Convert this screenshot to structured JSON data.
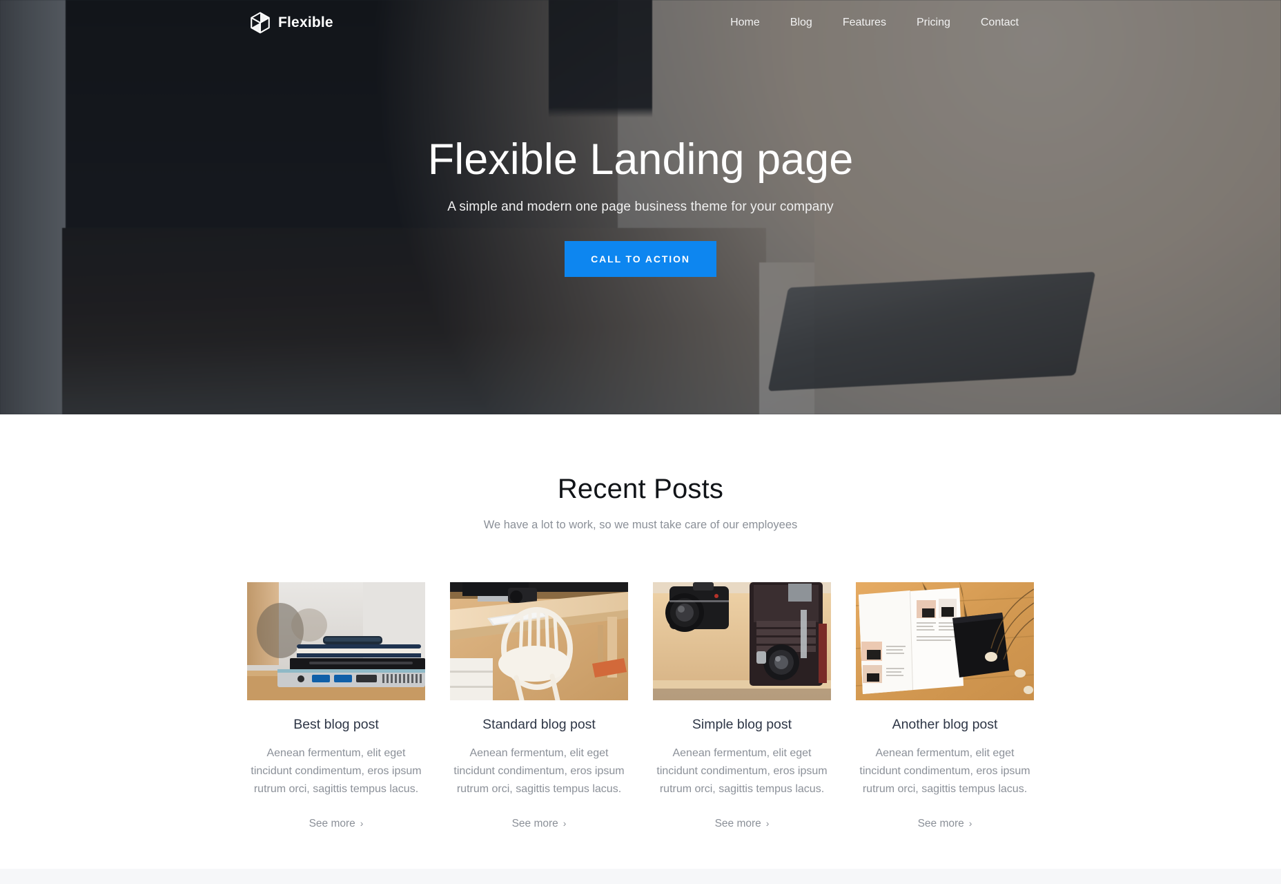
{
  "brand": {
    "name": "Flexible",
    "logo_icon": "cube-logo-icon"
  },
  "nav": {
    "items": [
      {
        "label": "Home"
      },
      {
        "label": "Blog"
      },
      {
        "label": "Features"
      },
      {
        "label": "Pricing"
      },
      {
        "label": "Contact"
      }
    ]
  },
  "hero": {
    "title": "Flexible Landing page",
    "subtitle": "A simple and modern one page business theme for your company",
    "cta_label": "CALL TO ACTION",
    "cta_color": "#0d86f0",
    "background": "photo of an open laptop on a desk showing a photo-editing app, with a graphics tablet and stylus alongside"
  },
  "posts": {
    "heading": "Recent Posts",
    "subheading": "We have a lot to work, so we must take care of our employees",
    "see_more_label": "See more",
    "chevron_icon": "chevron-right-icon",
    "cards": [
      {
        "title": "Best blog post",
        "excerpt": "Aenean fermentum, elit eget tincidunt condimentum, eros ipsum rutrum orci, sagittis tempus lacus.",
        "image_alt": "stack of laptops and a phone on a desk",
        "image_name": "post-thumb-laptops"
      },
      {
        "title": "Standard blog post",
        "excerpt": "Aenean fermentum, elit eget tincidunt condimentum, eros ipsum rutrum orci, sagittis tempus lacus.",
        "image_alt": "wooden desk with a white chair, keyboard and camera",
        "image_name": "post-thumb-desk-chair"
      },
      {
        "title": "Simple blog post",
        "excerpt": "Aenean fermentum, elit eget tincidunt condimentum, eros ipsum rutrum orci, sagittis tempus lacus.",
        "image_alt": "two vintage cameras on a wooden shelf",
        "image_name": "post-thumb-cameras"
      },
      {
        "title": "Another blog post",
        "excerpt": "Aenean fermentum, elit eget tincidunt condimentum, eros ipsum rutrum orci, sagittis tempus lacus.",
        "image_alt": "open magazine and black notebook on a wooden table",
        "image_name": "post-thumb-magazine"
      }
    ]
  },
  "colors": {
    "accent": "#0d86f0",
    "heading": "#111418",
    "muted_text": "#8b9098",
    "card_title": "#2e3646",
    "band": "#f6f7f9"
  }
}
